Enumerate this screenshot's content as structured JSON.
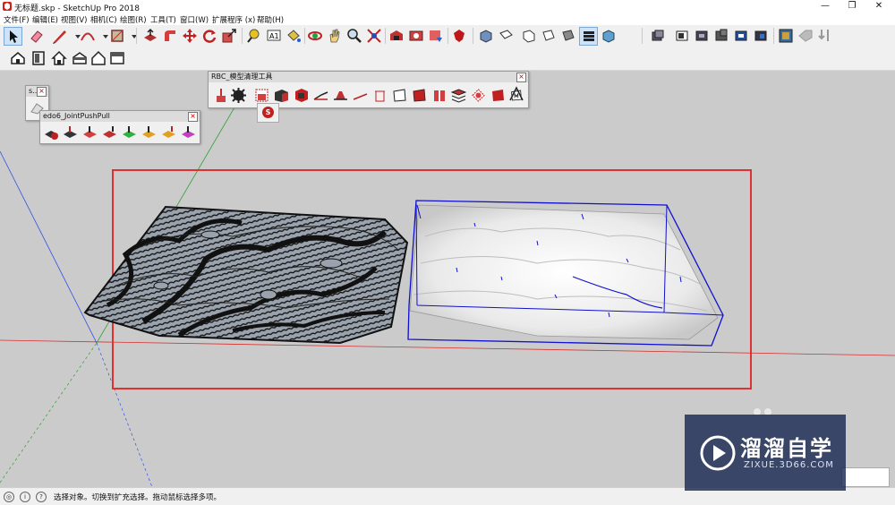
{
  "window": {
    "title": "无标题.skp - SketchUp Pro 2018",
    "minimize_glyph": "—",
    "maximize_glyph": "❐",
    "close_glyph": "✕"
  },
  "menu": [
    "文件(F)",
    "编辑(E)",
    "视图(V)",
    "相机(C)",
    "绘图(R)",
    "工具(T)",
    "窗口(W)",
    "扩展程序 (x)",
    "帮助(H)"
  ],
  "toolbar_icons_row1": [
    "select-arrow-icon",
    "eraser-icon",
    "pencil-line-icon",
    "arc-icon",
    "rectangle-icon",
    "push-pull-icon",
    "follow-me-icon",
    "move-icon",
    "rotate-icon",
    "scale-icon",
    "tape-measure-icon",
    "text-icon",
    "paint-bucket-icon",
    "orbit-icon",
    "pan-icon",
    "zoom-icon",
    "zoom-extents-icon",
    "warehouse-icon",
    "extension-warehouse-icon",
    "layout-icon",
    "ruby-icon",
    "iso-view-icon",
    "top-view-icon",
    "front-view-icon",
    "right-view-icon",
    "back-view-icon",
    "x-ray-icon",
    "shaded-icon",
    "section-plane-icon",
    "section-display-icon",
    "section-cut-icon",
    "section-fill-icon",
    "section-extra-icon",
    "style-icon",
    "dimension-icon",
    "tag-icon"
  ],
  "toolbar_icons_row2": [
    "iso-house-icon",
    "door-icon",
    "house-icon",
    "front-house-icon",
    "back-house-icon",
    "side-house-icon"
  ],
  "palettes": {
    "small": {
      "title": "s..."
    },
    "joint_push_pull": {
      "title": "edo6_JointPushPull"
    },
    "rbc": {
      "title": "RBC_模型清理工具",
      "badge": "S"
    }
  },
  "status": {
    "hint": "选择对象。切换到扩充选择。拖动鼠标选择多项。",
    "icons": [
      "geo-icon",
      "credit-icon",
      "help-icon"
    ]
  },
  "watermark": {
    "main": "溜溜自学",
    "sub": "ZIXUE.3D66.COM"
  },
  "colors": {
    "selection_red": "#e03030",
    "bbox_blue": "#1010d0",
    "axis_red": "#d83030",
    "axis_green": "#30a030",
    "axis_blue": "#3050e0"
  }
}
